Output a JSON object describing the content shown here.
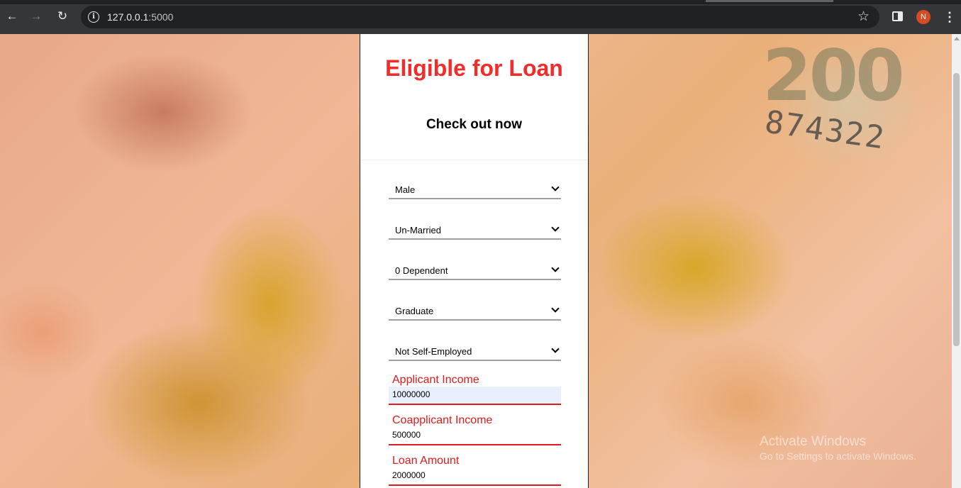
{
  "browser": {
    "url_host": "127.0.0.1",
    "url_port": ":5000",
    "avatar_initial": "N",
    "back_icon": "←",
    "forward_icon": "→",
    "reload_icon": "↻",
    "star_icon": "☆",
    "menu_icon": "⋮",
    "info_icon": "i"
  },
  "background": {
    "note_value": "200",
    "note_serial": "874322"
  },
  "card": {
    "title": "Eligible for Loan",
    "subtitle": "Check out now",
    "selects": [
      {
        "value": "Male"
      },
      {
        "value": "Un-Married"
      },
      {
        "value": "0 Dependent"
      },
      {
        "value": "Graduate"
      },
      {
        "value": "Not Self-Employed"
      }
    ],
    "fields": [
      {
        "label": "Applicant Income",
        "value": "10000000"
      },
      {
        "label": "Coapplicant Income",
        "value": "500000"
      },
      {
        "label": "Loan Amount",
        "value": "2000000"
      }
    ]
  },
  "watermark": {
    "title": "Activate Windows",
    "subtitle": "Go to Settings to activate Windows."
  },
  "colors": {
    "title_red": "#f22b2b",
    "label_red": "#e01b1b",
    "autofill_blue": "#e8f0fe"
  }
}
